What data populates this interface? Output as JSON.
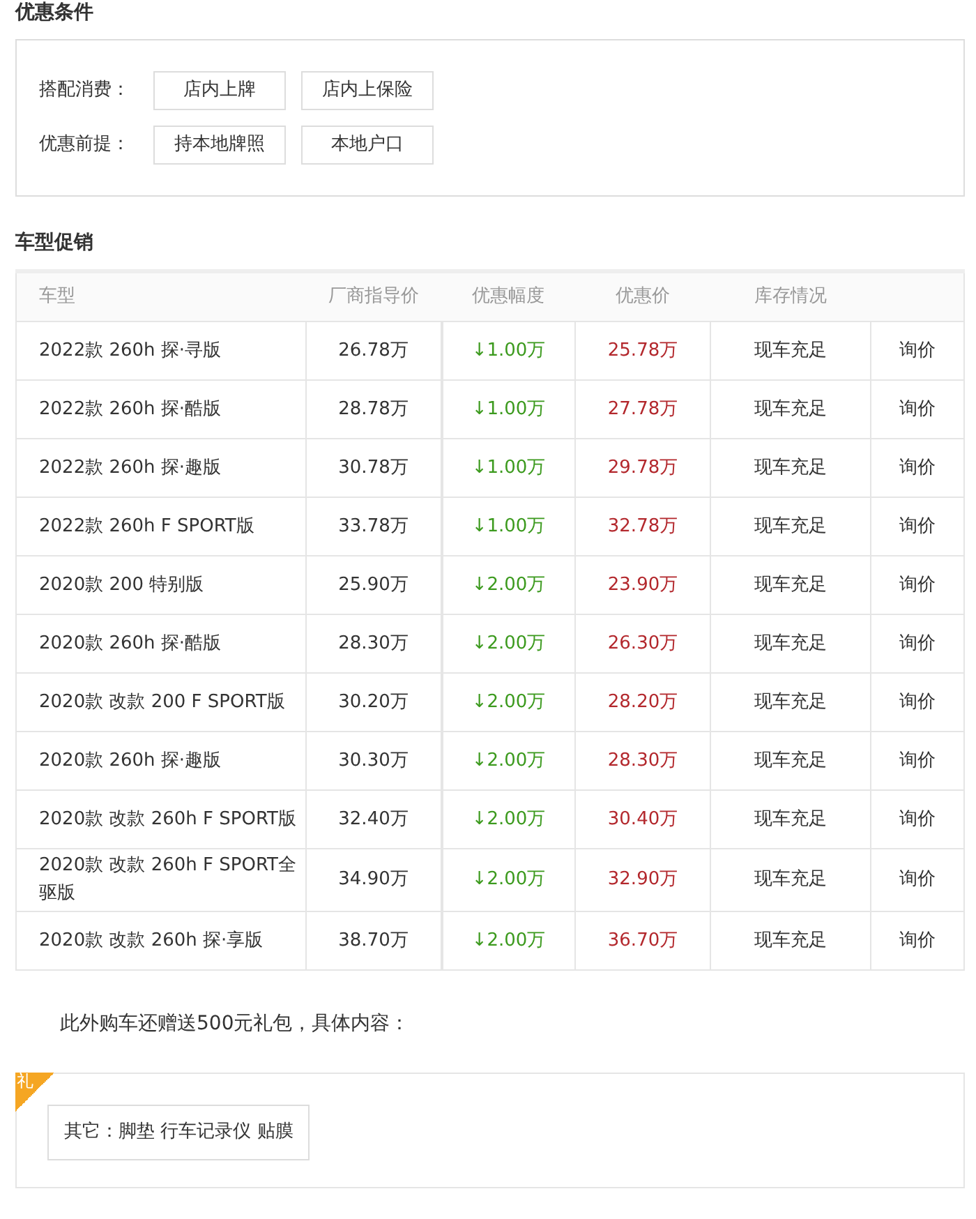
{
  "conditions": {
    "title": "优惠条件",
    "rows": [
      {
        "label": "搭配消费：",
        "tags": [
          "店内上牌",
          "店内上保险"
        ]
      },
      {
        "label": "优惠前提：",
        "tags": [
          "持本地牌照",
          "本地户口"
        ]
      }
    ]
  },
  "promotions": {
    "title": "车型促销",
    "columns": [
      "车型",
      "厂商指导价",
      "优惠幅度",
      "优惠价",
      "库存情况"
    ],
    "rows": [
      {
        "model": "2022款 260h 探·寻版",
        "msrp": "26.78万",
        "discount": "↓1.00万",
        "price": "25.78万",
        "stock": "现车充足",
        "action": "询价"
      },
      {
        "model": "2022款 260h 探·酷版",
        "msrp": "28.78万",
        "discount": "↓1.00万",
        "price": "27.78万",
        "stock": "现车充足",
        "action": "询价"
      },
      {
        "model": "2022款 260h 探·趣版",
        "msrp": "30.78万",
        "discount": "↓1.00万",
        "price": "29.78万",
        "stock": "现车充足",
        "action": "询价"
      },
      {
        "model": "2022款 260h F SPORT版",
        "msrp": "33.78万",
        "discount": "↓1.00万",
        "price": "32.78万",
        "stock": "现车充足",
        "action": "询价"
      },
      {
        "model": "2020款 200 特别版",
        "msrp": "25.90万",
        "discount": "↓2.00万",
        "price": "23.90万",
        "stock": "现车充足",
        "action": "询价"
      },
      {
        "model": "2020款 260h 探·酷版",
        "msrp": "28.30万",
        "discount": "↓2.00万",
        "price": "26.30万",
        "stock": "现车充足",
        "action": "询价"
      },
      {
        "model": "2020款 改款 200 F SPORT版",
        "msrp": "30.20万",
        "discount": "↓2.00万",
        "price": "28.20万",
        "stock": "现车充足",
        "action": "询价"
      },
      {
        "model": "2020款 260h 探·趣版",
        "msrp": "30.30万",
        "discount": "↓2.00万",
        "price": "28.30万",
        "stock": "现车充足",
        "action": "询价"
      },
      {
        "model": "2020款 改款 260h F SPORT版",
        "msrp": "32.40万",
        "discount": "↓2.00万",
        "price": "30.40万",
        "stock": "现车充足",
        "action": "询价"
      },
      {
        "model": "2020款 改款 260h F SPORT全驱版",
        "msrp": "34.90万",
        "discount": "↓2.00万",
        "price": "32.90万",
        "stock": "现车充足",
        "action": "询价"
      },
      {
        "model": "2020款 改款 260h 探·享版",
        "msrp": "38.70万",
        "discount": "↓2.00万",
        "price": "36.70万",
        "stock": "现车充足",
        "action": "询价"
      }
    ]
  },
  "gift": {
    "intro": "此外购车还赠送500元礼包，具体内容：",
    "corner": "礼",
    "content": "其它：脚垫 行车记录仪 贴膜"
  }
}
